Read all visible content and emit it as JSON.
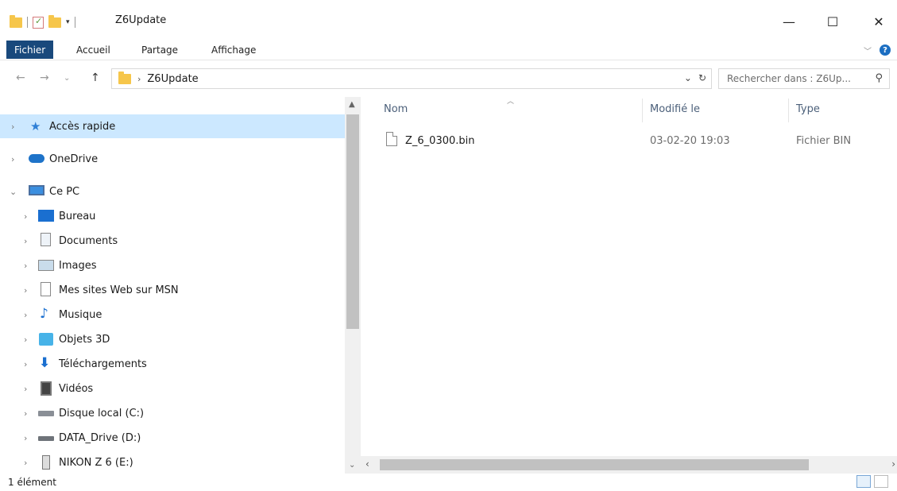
{
  "window": {
    "title": "Z6Update",
    "minimize_glyph": "—",
    "maximize_glyph": "☐",
    "close_glyph": "✕"
  },
  "ribbon": {
    "tabs": [
      "Fichier",
      "Accueil",
      "Partage",
      "Affichage"
    ]
  },
  "address": {
    "path": "Z6Update",
    "search_placeholder": "Rechercher dans : Z6Up..."
  },
  "nav": {
    "items": [
      {
        "label": "Accès rapide",
        "icon": "star-icon",
        "selected": true
      },
      {
        "label": "OneDrive",
        "icon": "cloud-icon"
      },
      {
        "label": "Ce PC",
        "icon": "computer-icon",
        "expanded": true
      },
      {
        "label": "Bureau",
        "icon": "desktop-icon"
      },
      {
        "label": "Documents",
        "icon": "documents-icon"
      },
      {
        "label": "Images",
        "icon": "images-icon"
      },
      {
        "label": "Mes sites Web sur MSN",
        "icon": "web-page-icon"
      },
      {
        "label": "Musique",
        "icon": "music-note-icon"
      },
      {
        "label": "Objets 3D",
        "icon": "cube-icon"
      },
      {
        "label": "Téléchargements",
        "icon": "download-arrow-icon"
      },
      {
        "label": "Vidéos",
        "icon": "film-icon"
      },
      {
        "label": "Disque local (C:)",
        "icon": "local-disk-icon"
      },
      {
        "label": "DATA_Drive (D:)",
        "icon": "drive-icon"
      },
      {
        "label": "NIKON Z 6  (E:)",
        "icon": "removable-drive-icon"
      }
    ]
  },
  "columns": {
    "name": "Nom",
    "modified": "Modifié le",
    "type": "Type"
  },
  "files": [
    {
      "name": "Z_6_0300.bin",
      "modified": "03-02-20 19:03",
      "type": "Fichier BIN"
    }
  ],
  "status": {
    "count": "1 élément"
  },
  "colors": {
    "selection": "#cce8ff",
    "file_tab": "#19497c",
    "folder": "#f6c64b",
    "header_text": "#4c607a"
  }
}
